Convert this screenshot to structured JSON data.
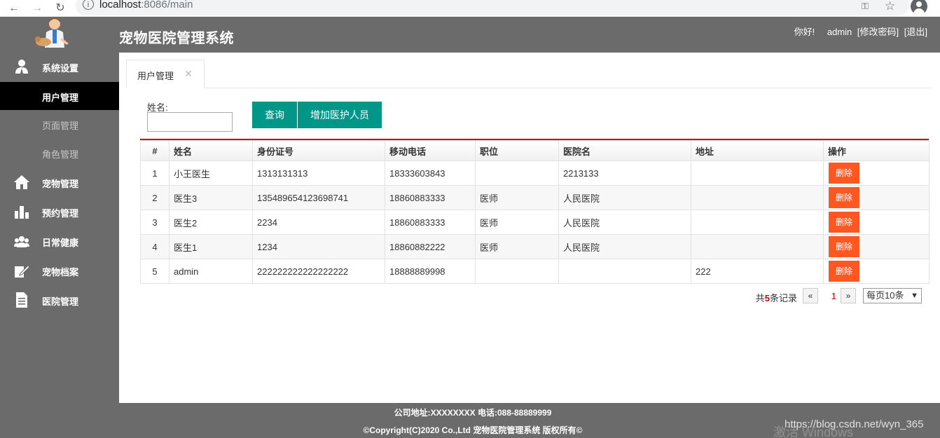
{
  "browser": {
    "url_host": "localhost",
    "url_rest": ":8086/main"
  },
  "header": {
    "title": "宠物医院管理系统",
    "greeting": "你好!",
    "username": "admin",
    "change_password": "[修改密码]",
    "logout": "[退出]"
  },
  "sidebar": {
    "items": [
      {
        "label": "系统设置",
        "icon": "user-icon"
      },
      {
        "label": "用户管理"
      },
      {
        "label": "页面管理"
      },
      {
        "label": "角色管理"
      },
      {
        "label": "宠物管理",
        "icon": "home-icon"
      },
      {
        "label": "预约管理",
        "icon": "bar-chart-icon"
      },
      {
        "label": "日常健康",
        "icon": "group-icon"
      },
      {
        "label": "宠物档案",
        "icon": "edit-icon"
      },
      {
        "label": "医院管理",
        "icon": "document-icon"
      }
    ]
  },
  "tabs": [
    {
      "label": "用户管理",
      "close": "✕"
    }
  ],
  "search": {
    "label": "姓名:",
    "value": "",
    "query_button": "查询",
    "add_button": "增加医护人员"
  },
  "table": {
    "headers": [
      "#",
      "姓名",
      "身份证号",
      "移动电话",
      "职位",
      "医院名",
      "地址",
      "操作"
    ],
    "rows": [
      {
        "no": "1",
        "name": "小王医生",
        "id_card": "1313131313",
        "phone": "18333603843",
        "position": "",
        "hospital": "2213133",
        "address": "",
        "action": "删除"
      },
      {
        "no": "2",
        "name": "医生3",
        "id_card": "135489654123698741",
        "phone": "18860883333",
        "position": "医师",
        "hospital": "人民医院",
        "address": "",
        "action": "删除"
      },
      {
        "no": "3",
        "name": "医生2",
        "id_card": "2234",
        "phone": "18860883333",
        "position": "医师",
        "hospital": "人民医院",
        "address": "",
        "action": "删除"
      },
      {
        "no": "4",
        "name": "医生1",
        "id_card": "1234",
        "phone": "18860882222",
        "position": "医师",
        "hospital": "人民医院",
        "address": "",
        "action": "删除"
      },
      {
        "no": "5",
        "name": "admin",
        "id_card": "222222222222222222",
        "phone": "18888889998",
        "position": "",
        "hospital": "",
        "address": "222",
        "action": "删除"
      }
    ]
  },
  "pager": {
    "total_prefix": "共",
    "total_count": "5",
    "total_suffix": "条记录",
    "prev": "«",
    "current_page": "1",
    "next": "»",
    "page_size": "每页10条"
  },
  "footer": {
    "line1": "公司地址:XXXXXXXX 电话:088-88889999",
    "line2": "©Copyright(C)2020 Co.,Ltd 宠物医院管理系统 版权所有©"
  },
  "watermark": "https://blog.csdn.net/wyn_365",
  "os_watermark": "激活 Windows",
  "colors": {
    "header_bg": "#6b6b6b",
    "active_menu_bg": "#000000",
    "primary_button": "#009688",
    "danger_button": "#ff5722",
    "table_top_border": "#cc0000"
  }
}
